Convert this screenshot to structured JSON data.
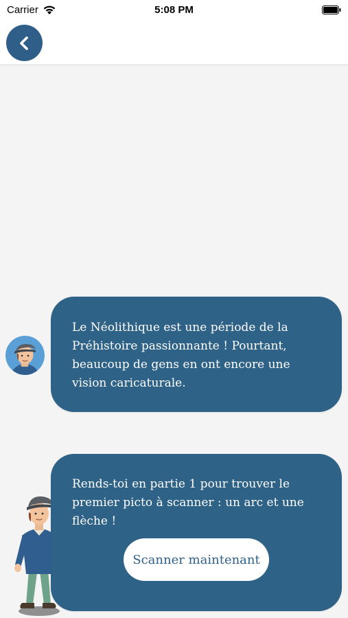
{
  "status_bar": {
    "carrier": "Carrier",
    "time": "5:08 PM",
    "icons": [
      "wifi-icon",
      "battery-icon"
    ]
  },
  "nav": {
    "back_icon": "chevron-left-icon"
  },
  "messages": [
    {
      "text": "Le Néolithique est une période de la Préhistoire passionnante ! Pourtant, beaucoup de gens en ont encore une vision caricaturale."
    },
    {
      "text": "Rends-toi en partie 1 pour trouver le premier picto à scanner : un arc et une flèche !",
      "button_label": "Scanner maintenant"
    }
  ],
  "colors": {
    "accent": "#2f5f88",
    "bubble": "#2f6287",
    "background": "#f4f4f4"
  }
}
